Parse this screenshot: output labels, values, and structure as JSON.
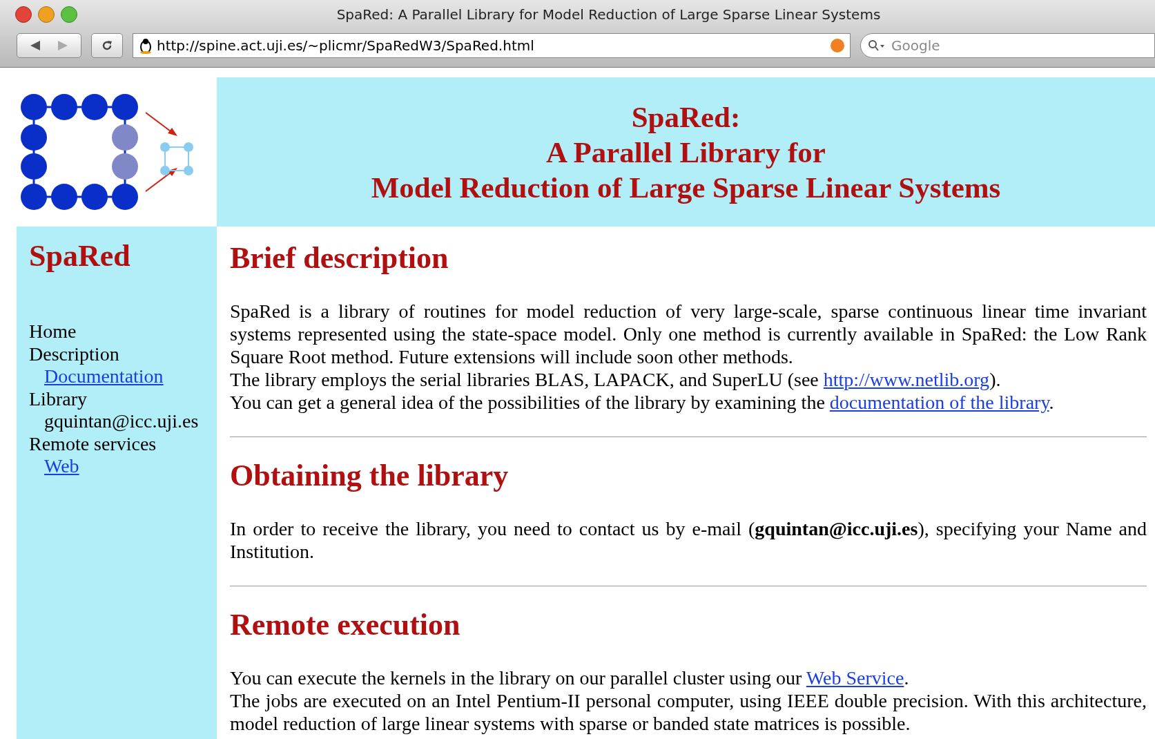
{
  "window": {
    "title": "SpaRed: A Parallel Library for Model Reduction of Large Sparse Linear Systems"
  },
  "toolbar": {
    "url": "http://spine.act.uji.es/~plicmr/SpaRedW3/SpaRed.html",
    "search": {
      "placeholder": "Google"
    }
  },
  "banner": {
    "lines": [
      "SpaRed:",
      "A Parallel Library for",
      "Model Reduction of Large Sparse Linear Systems"
    ]
  },
  "sidebar": {
    "title": "SpaRed",
    "items": [
      {
        "label": "Home"
      },
      {
        "label": "Description",
        "children": [
          {
            "label": "Documentation",
            "kind": "link"
          }
        ]
      },
      {
        "label": "Library",
        "children": [
          {
            "label": "gquintan@icc.uji.es",
            "kind": "text"
          }
        ]
      },
      {
        "label": "Remote services",
        "children": [
          {
            "label": "Web",
            "kind": "link"
          }
        ]
      }
    ]
  },
  "sections": [
    {
      "heading": "Brief description",
      "paragraphs": [
        [
          {
            "kind": "text",
            "text": "SpaRed is a library of routines for model reduction of very large-scale, sparse continuous linear time invariant systems represented using the state-space model. Only one method is currently available in SpaRed: the Low Rank Square Root method. Future extensions will include soon other methods."
          }
        ],
        [
          {
            "kind": "text",
            "text": "The library employs the serial libraries BLAS, LAPACK, and SuperLU (see "
          },
          {
            "kind": "link",
            "text": "http://www.netlib.org"
          },
          {
            "kind": "text",
            "text": ")."
          }
        ],
        [
          {
            "kind": "text",
            "text": "You can get a general idea of the possibilities of the library by examining the "
          },
          {
            "kind": "link",
            "text": "documentation of the library"
          },
          {
            "kind": "text",
            "text": "."
          }
        ]
      ]
    },
    {
      "heading": "Obtaining the library",
      "paragraphs": [
        [
          {
            "kind": "text",
            "text": "In order to receive the library, you need to contact us by e-mail (**gquintan@icc.uji.es**), specifying your Name and Institution."
          }
        ]
      ]
    },
    {
      "heading": "Remote execution",
      "paragraphs": [
        [
          {
            "kind": "text",
            "text": "You can execute the kernels in the library on our parallel cluster using our "
          },
          {
            "kind": "link",
            "text": "Web Service"
          },
          {
            "kind": "text",
            "text": "."
          }
        ],
        [
          {
            "kind": "text",
            "text": "The jobs are executed on an Intel Pentium-II personal computer, using IEEE double precision. With this architecture, model reduction of large linear systems with sparse or banded state matrices is possible."
          }
        ]
      ]
    }
  ]
}
